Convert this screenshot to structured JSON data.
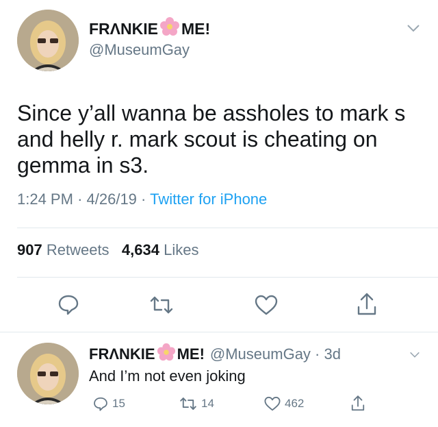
{
  "main_tweet": {
    "display_name_part1": "FRΛNKIE",
    "display_name_part2": "ME!",
    "handle": "@MuseumGay",
    "text": "Since y’all wanna be assholes to mark s and helly r. mark scout is cheating on gemma in s3.",
    "time": "1:24 PM",
    "date": "4/26/19",
    "source": "Twitter for iPhone",
    "retweets": "907",
    "retweets_label": "Retweets",
    "likes": "4,634",
    "likes_label": "Likes"
  },
  "reply_tweet": {
    "display_name_part1": "FRΛNKIE",
    "display_name_part2": "ME!",
    "handle": "@MuseumGay",
    "age": "3d",
    "text": "And I’m not even joking",
    "replies": "15",
    "retweets": "14",
    "likes": "462"
  },
  "colors": {
    "text": "#14171a",
    "secondary": "#657786",
    "link": "#1da1f2",
    "divider": "#e1e8ed",
    "flower": "#f4a6c6"
  },
  "icons": [
    "reply-icon",
    "retweet-icon",
    "like-icon",
    "share-icon",
    "chevron-down-icon",
    "flower-emoji"
  ]
}
